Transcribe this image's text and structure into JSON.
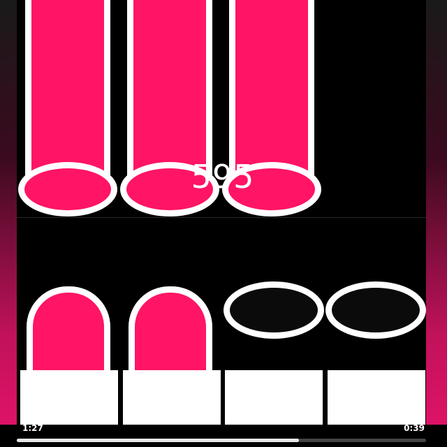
{
  "game": {
    "score": "595",
    "accent_color": "#ff1466",
    "lanes": 4
  },
  "video": {
    "elapsed": "1:27",
    "remaining": "0:39",
    "progress": 0.69
  }
}
